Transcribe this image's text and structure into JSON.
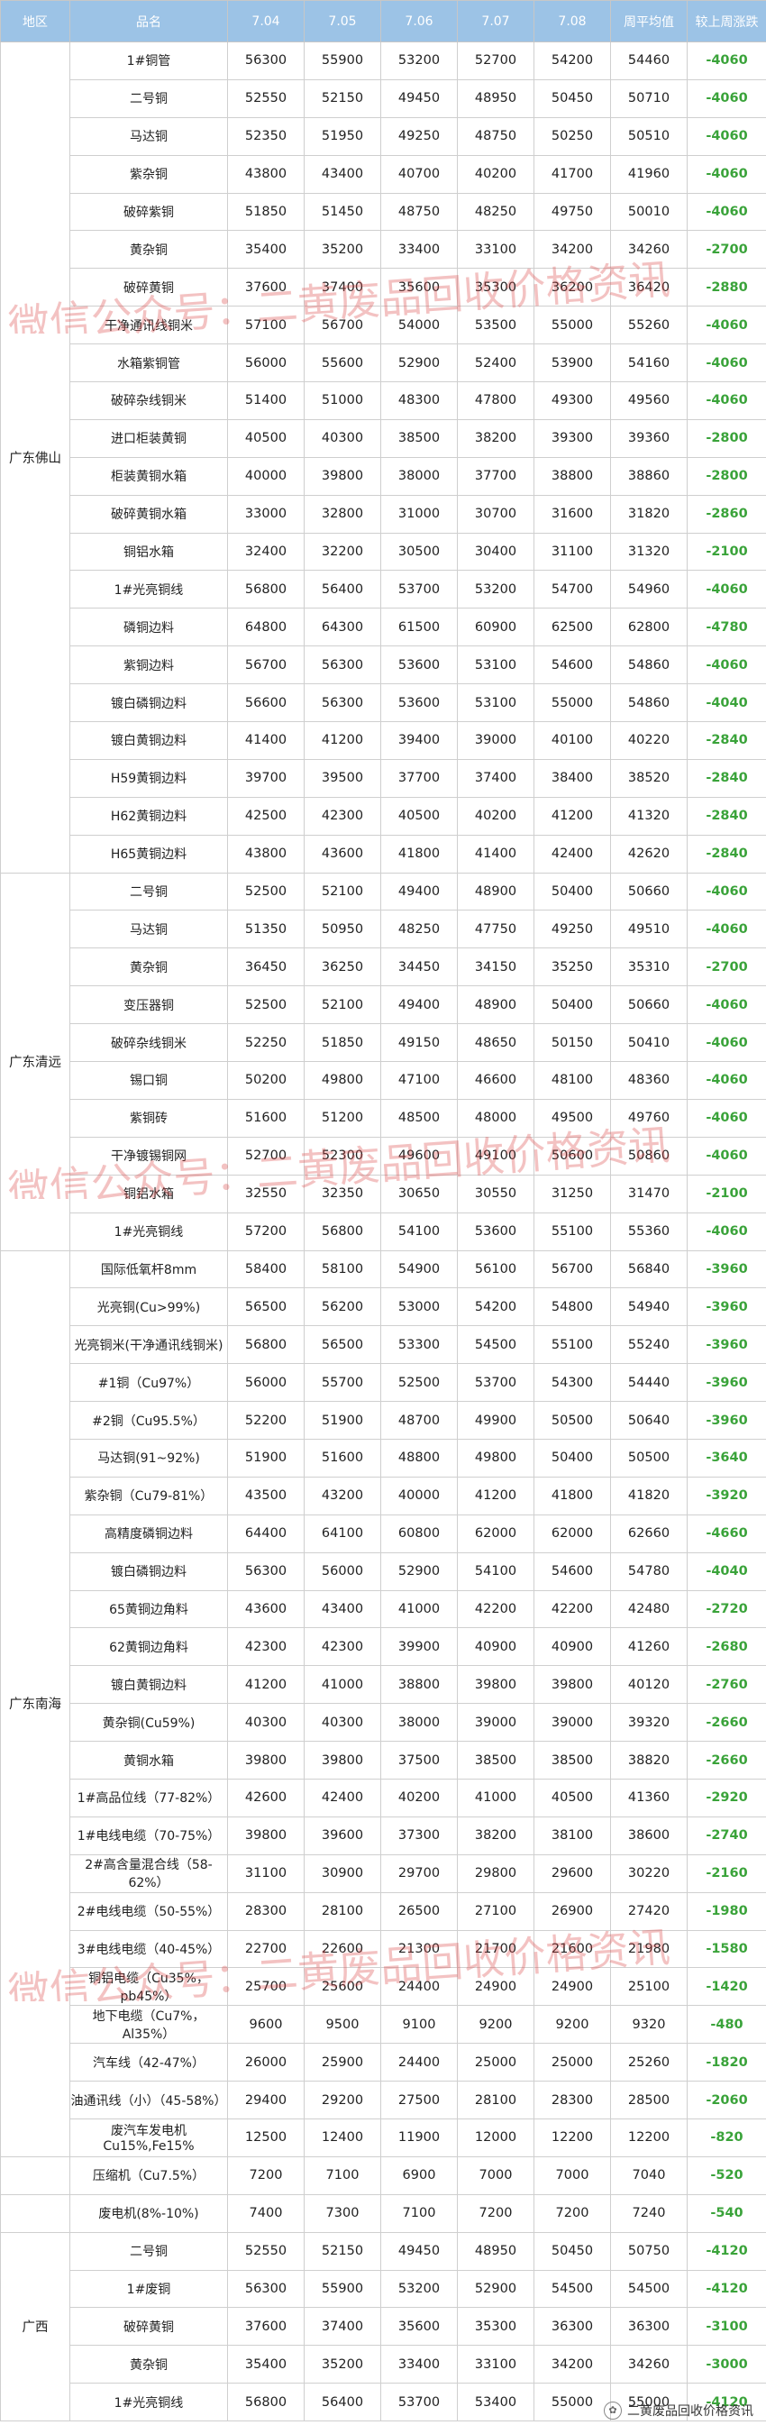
{
  "headers": [
    "地区",
    "品名",
    "7.04",
    "7.05",
    "7.06",
    "7.07",
    "7.08",
    "周平均值",
    "较上周涨跌"
  ],
  "regions": [
    {
      "name": "广东佛山",
      "rows": [
        [
          "1#铜管",
          "56300",
          "55900",
          "53200",
          "52700",
          "54200",
          "54460",
          "-4060"
        ],
        [
          "二号铜",
          "52550",
          "52150",
          "49450",
          "48950",
          "50450",
          "50710",
          "-4060"
        ],
        [
          "马达铜",
          "52350",
          "51950",
          "49250",
          "48750",
          "50250",
          "50510",
          "-4060"
        ],
        [
          "紫杂铜",
          "43800",
          "43400",
          "40700",
          "40200",
          "41700",
          "41960",
          "-4060"
        ],
        [
          "破碎紫铜",
          "51850",
          "51450",
          "48750",
          "48250",
          "49750",
          "50010",
          "-4060"
        ],
        [
          "黄杂铜",
          "35400",
          "35200",
          "33400",
          "33100",
          "34200",
          "34260",
          "-2700"
        ],
        [
          "破碎黄铜",
          "37600",
          "37400",
          "35600",
          "35300",
          "36200",
          "36420",
          "-2880"
        ],
        [
          "干净通讯线铜米",
          "57100",
          "56700",
          "54000",
          "53500",
          "55000",
          "55260",
          "-4060"
        ],
        [
          "水箱紫铜管",
          "56000",
          "55600",
          "52900",
          "52400",
          "53900",
          "54160",
          "-4060"
        ],
        [
          "破碎杂线铜米",
          "51400",
          "51000",
          "48300",
          "47800",
          "49300",
          "49560",
          "-4060"
        ],
        [
          "进口柜装黄铜",
          "40500",
          "40300",
          "38500",
          "38200",
          "39300",
          "39360",
          "-2800"
        ],
        [
          "柜装黄铜水箱",
          "40000",
          "39800",
          "38000",
          "37700",
          "38800",
          "38860",
          "-2800"
        ],
        [
          "破碎黄铜水箱",
          "33000",
          "32800",
          "31000",
          "30700",
          "31600",
          "31820",
          "-2860"
        ],
        [
          "铜铝水箱",
          "32400",
          "32200",
          "30500",
          "30400",
          "31100",
          "31320",
          "-2100"
        ],
        [
          "1#光亮铜线",
          "56800",
          "56400",
          "53700",
          "53200",
          "54700",
          "54960",
          "-4060"
        ],
        [
          "磷铜边料",
          "64800",
          "64300",
          "61500",
          "60900",
          "62500",
          "62800",
          "-4780"
        ],
        [
          "紫铜边料",
          "56700",
          "56300",
          "53600",
          "53100",
          "54600",
          "54860",
          "-4060"
        ],
        [
          "镀白磷铜边料",
          "56600",
          "56300",
          "53600",
          "53100",
          "55000",
          "54860",
          "-4040"
        ],
        [
          "镀白黄铜边料",
          "41400",
          "41200",
          "39400",
          "39000",
          "40100",
          "40220",
          "-2840"
        ],
        [
          "H59黄铜边料",
          "39700",
          "39500",
          "37700",
          "37400",
          "38400",
          "38520",
          "-2840"
        ],
        [
          "H62黄铜边料",
          "42500",
          "42300",
          "40500",
          "40200",
          "41200",
          "41320",
          "-2840"
        ],
        [
          "H65黄铜边料",
          "43800",
          "43600",
          "41800",
          "41400",
          "42400",
          "42620",
          "-2840"
        ]
      ]
    },
    {
      "name": "广东清远",
      "rows": [
        [
          "二号铜",
          "52500",
          "52100",
          "49400",
          "48900",
          "50400",
          "50660",
          "-4060"
        ],
        [
          "马达铜",
          "51350",
          "50950",
          "48250",
          "47750",
          "49250",
          "49510",
          "-4060"
        ],
        [
          "黄杂铜",
          "36450",
          "36250",
          "34450",
          "34150",
          "35250",
          "35310",
          "-2700"
        ],
        [
          "变压器铜",
          "52500",
          "52100",
          "49400",
          "48900",
          "50400",
          "50660",
          "-4060"
        ],
        [
          "破碎杂线铜米",
          "52250",
          "51850",
          "49150",
          "48650",
          "50150",
          "50410",
          "-4060"
        ],
        [
          "锡口铜",
          "50200",
          "49800",
          "47100",
          "46600",
          "48100",
          "48360",
          "-4060"
        ],
        [
          "紫铜砖",
          "51600",
          "51200",
          "48500",
          "48000",
          "49500",
          "49760",
          "-4060"
        ],
        [
          "干净镀锡铜网",
          "52700",
          "52300",
          "49600",
          "49100",
          "50600",
          "50860",
          "-4060"
        ],
        [
          "铜铝水箱",
          "32550",
          "32350",
          "30650",
          "30550",
          "31250",
          "31470",
          "-2100"
        ],
        [
          "1#光亮铜线",
          "57200",
          "56800",
          "54100",
          "53600",
          "55100",
          "55360",
          "-4060"
        ]
      ]
    },
    {
      "name": "广东南海",
      "rows": [
        [
          "国际低氧杆8mm",
          "58400",
          "58100",
          "54900",
          "56100",
          "56700",
          "56840",
          "-3960"
        ],
        [
          "光亮铜(Cu>99%)",
          "56500",
          "56200",
          "53000",
          "54200",
          "54800",
          "54940",
          "-3960"
        ],
        [
          "光亮铜米(干净通讯线铜米)",
          "56800",
          "56500",
          "53300",
          "54500",
          "55100",
          "55240",
          "-3960"
        ],
        [
          "#1铜（Cu97%）",
          "56000",
          "55700",
          "52500",
          "53700",
          "54300",
          "54440",
          "-3960"
        ],
        [
          "#2铜（Cu95.5%）",
          "52200",
          "51900",
          "48700",
          "49900",
          "50500",
          "50640",
          "-3960"
        ],
        [
          "马达铜(91~92%)",
          "51900",
          "51600",
          "48800",
          "49800",
          "50400",
          "50500",
          "-3640"
        ],
        [
          "紫杂铜（Cu79-81%）",
          "43500",
          "43200",
          "40000",
          "41200",
          "41800",
          "41820",
          "-3920"
        ],
        [
          "高精度磷铜边料",
          "64400",
          "64100",
          "60800",
          "62000",
          "62000",
          "62660",
          "-4660"
        ],
        [
          "镀白磷铜边料",
          "56300",
          "56000",
          "52900",
          "54100",
          "54600",
          "54780",
          "-4040"
        ],
        [
          "65黄铜边角料",
          "43600",
          "43400",
          "41000",
          "42200",
          "42200",
          "42480",
          "-2720"
        ],
        [
          "62黄铜边角料",
          "42300",
          "42300",
          "39900",
          "40900",
          "40900",
          "41260",
          "-2680"
        ],
        [
          "镀白黄铜边料",
          "41200",
          "41000",
          "38800",
          "39800",
          "39800",
          "40120",
          "-2760"
        ],
        [
          "黄杂铜(Cu59%)",
          "40300",
          "40300",
          "38000",
          "39000",
          "39000",
          "39320",
          "-2660"
        ],
        [
          "黄铜水箱",
          "39800",
          "39800",
          "37500",
          "38500",
          "38500",
          "38820",
          "-2660"
        ],
        [
          "1#高品位线（77-82%）",
          "42600",
          "42400",
          "40200",
          "41000",
          "40500",
          "41360",
          "-2920"
        ],
        [
          "1#电线电缆（70-75%）",
          "39800",
          "39600",
          "37300",
          "38200",
          "38100",
          "38600",
          "-2740"
        ],
        [
          "2#高含量混合线（58-62%）",
          "31100",
          "30900",
          "29700",
          "29800",
          "29600",
          "30220",
          "-2160"
        ],
        [
          "2#电线电缆（50-55%）",
          "28300",
          "28100",
          "26500",
          "27100",
          "26900",
          "27420",
          "-1980"
        ],
        [
          "3#电线电缆（40-45%）",
          "22700",
          "22600",
          "21300",
          "21700",
          "21600",
          "21980",
          "-1580"
        ],
        [
          "铜铝电缆（Cu35%，pb45%）",
          "25700",
          "25600",
          "24400",
          "24900",
          "24900",
          "25100",
          "-1420"
        ],
        [
          "地下电缆（Cu7%，Al35%）",
          "9600",
          "9500",
          "9100",
          "9200",
          "9200",
          "9320",
          "-480"
        ],
        [
          "汽车线（42-47%）",
          "26000",
          "25900",
          "24400",
          "25000",
          "25000",
          "25260",
          "-1820"
        ],
        [
          "油通讯线（小）（45-58%）",
          "29400",
          "29200",
          "27500",
          "28100",
          "28300",
          "28500",
          "-2060"
        ],
        [
          "废汽车发电机Cu15%,Fe15%",
          "12500",
          "12400",
          "11900",
          "12000",
          "12200",
          "12200",
          "-820"
        ]
      ]
    },
    {
      "name": "",
      "rows": [
        [
          "压缩机（Cu7.5%）",
          "7200",
          "7100",
          "6900",
          "7000",
          "7000",
          "7040",
          "-520"
        ]
      ]
    },
    {
      "name": "",
      "rows": [
        [
          "废电机(8%-10%)",
          "7400",
          "7300",
          "7100",
          "7200",
          "7200",
          "7240",
          "-540"
        ]
      ]
    },
    {
      "name": "广西",
      "rows": [
        [
          "二号铜",
          "52550",
          "52150",
          "49450",
          "48950",
          "50450",
          "50750",
          "-4120"
        ],
        [
          "1#废铜",
          "56300",
          "55900",
          "53200",
          "52900",
          "54500",
          "54500",
          "-4120"
        ],
        [
          "破碎黄铜",
          "37600",
          "37400",
          "35600",
          "35300",
          "36300",
          "36300",
          "-3100"
        ],
        [
          "黄杂铜",
          "35400",
          "35200",
          "33400",
          "33100",
          "34200",
          "34260",
          "-3000"
        ],
        [
          "1#光亮铜线",
          "56800",
          "56400",
          "53700",
          "53400",
          "55000",
          "55000",
          "-4120"
        ]
      ]
    }
  ],
  "watermark": "微信公众号：二黄废品回收价格资讯",
  "footer": "二黄废品回收价格资讯",
  "colors": {
    "header_bg": "#9cc3e6",
    "change": "#3aa33a",
    "watermark": "#dc4646"
  }
}
